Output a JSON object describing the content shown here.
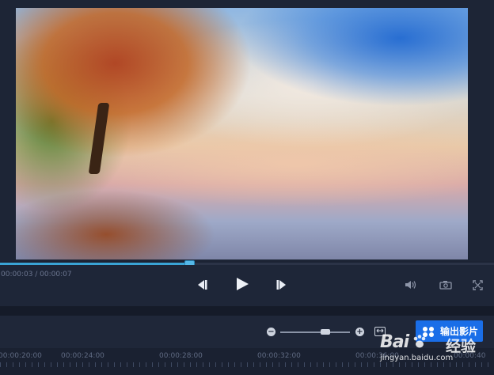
{
  "preview": {
    "playback_progress": 0.385
  },
  "controls": {
    "time": "00:00:03 / 00:00:07",
    "prev_icon": "step-back-icon",
    "play_icon": "play-icon",
    "next_icon": "step-forward-icon",
    "volume_icon": "volume-icon",
    "snapshot_icon": "camera-icon",
    "fullscreen_icon": "fullscreen-icon"
  },
  "timeline_toolbar": {
    "zoom_out_label": "−",
    "zoom_in_label": "+",
    "zoom_level": 0.65,
    "fit_icon": "fit-timeline-icon",
    "export_label": "输出影片",
    "export_icon": "film-export-icon"
  },
  "ruler": {
    "labels": [
      "00:00:20:00",
      "00:00:24:00",
      "00:00:28:00",
      "00:00:32:00",
      "00:00:36:00",
      "00:00:40"
    ]
  },
  "watermark": {
    "brand": "Bai",
    "product": "经验",
    "url": "jingyan.baidu.com"
  },
  "colors": {
    "accent": "#1a6ee8",
    "progress": "#3aa4d6",
    "panel_bg": "#1e2638"
  }
}
